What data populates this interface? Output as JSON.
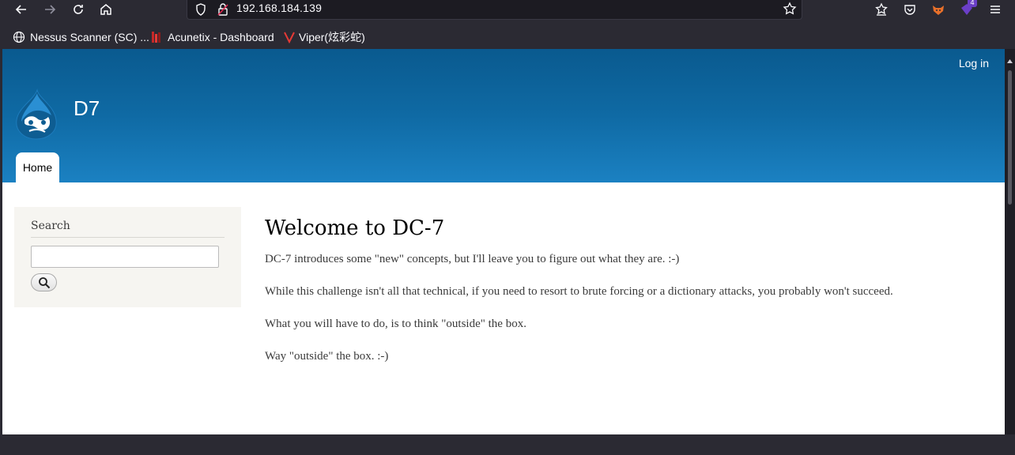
{
  "browser": {
    "url": "192.168.184.139",
    "bookmarks": [
      {
        "label": "Nessus Scanner (SC) ...",
        "icon": "globe-icon"
      },
      {
        "label": "Acunetix - Dashboard",
        "icon": "acunetix-icon"
      },
      {
        "label": "Viper(炫彩蛇)",
        "icon": "viper-icon"
      }
    ],
    "extension_badge": "4"
  },
  "site": {
    "name": "D7",
    "login_label": "Log in",
    "tabs": [
      {
        "label": "Home"
      }
    ]
  },
  "sidebar": {
    "search_title": "Search",
    "search_value": ""
  },
  "main": {
    "title": "Welcome to DC-7",
    "paragraphs": [
      "DC-7 introduces some \"new\" concepts, but I'll leave you to figure out what they are.  :-)",
      "While this challenge isn't all that technical, if you need to resort to brute forcing or a dictionary attacks, you probably won't succeed.",
      "What you will have to do, is to think \"outside\" the box.",
      "Way \"outside\" the box.  :-)"
    ]
  },
  "colors": {
    "header_top": "#0a5a8f",
    "header_bottom": "#1b81c2",
    "chrome_bg": "#2b2a33"
  }
}
